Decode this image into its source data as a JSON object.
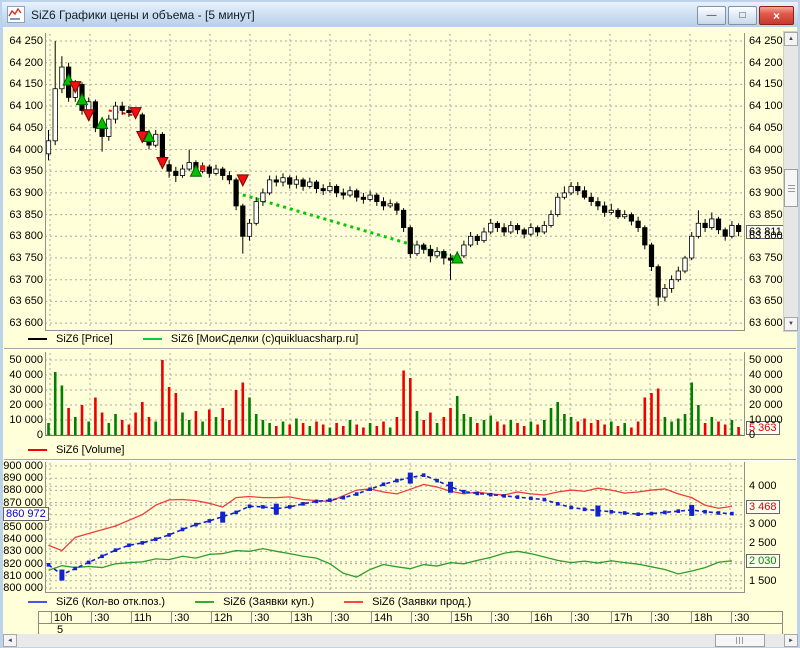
{
  "window": {
    "title": "SiZ6 Графики цены и объема - [5 минут]"
  },
  "titlebar_buttons": {
    "minimize": "—",
    "maximize": "□",
    "close": "×"
  },
  "price_panel": {
    "y_ticks": [
      "64 250",
      "64 200",
      "64 150",
      "64 100",
      "64 050",
      "64 000",
      "63 950",
      "63 900",
      "63 850",
      "63 800",
      "63 750",
      "63 700",
      "63 650",
      "63 600"
    ],
    "last_price": "63 811",
    "legend": [
      {
        "color": "#000000",
        "label": "SiZ6 [Price]"
      },
      {
        "color": "#00cc44",
        "label": "SiZ6 [МоиСделки (с)quikluacsharp.ru]"
      }
    ]
  },
  "volume_panel": {
    "y_ticks": [
      "50 000",
      "40 000",
      "30 000",
      "20 000",
      "10 000",
      "0"
    ],
    "last_value": "5 363",
    "legend": [
      {
        "color": "#ff0000",
        "label": "SiZ6 [Volume]"
      }
    ]
  },
  "bottom_panel": {
    "left_ticks": [
      {
        "label": "900 000",
        "v": 900000
      },
      {
        "label": "890 000",
        "v": 890000
      },
      {
        "label": "880 000",
        "v": 880000
      },
      {
        "label": "870 000",
        "v": 870000
      },
      {
        "label": "850 000",
        "v": 850000
      },
      {
        "label": "840 000",
        "v": 840000
      },
      {
        "label": "830 000",
        "v": 830000
      },
      {
        "label": "820 000",
        "v": 820000
      },
      {
        "label": "810 000",
        "v": 810000
      },
      {
        "label": "800 000",
        "v": 800000
      }
    ],
    "left_badge": "860 972",
    "right_ticks": [
      {
        "label": "4 000",
        "v": 4000
      },
      {
        "label": "3 000",
        "v": 3000
      },
      {
        "label": "2 500",
        "v": 2500
      },
      {
        "label": "1 500",
        "v": 1500
      }
    ],
    "sell_badge": "3 468",
    "buy_badge": "2 030",
    "legend": [
      {
        "color": "#4455ee",
        "label": "SiZ6 (Кол-во отк.поз.)"
      },
      {
        "color": "#33aa33",
        "label": "SiZ6 (Заявки куп.)"
      },
      {
        "color": "#ff4444",
        "label": "SiZ6 (Заявки прод.)"
      }
    ]
  },
  "time_axis": {
    "labels": [
      "10h",
      ":30",
      "11h",
      ":30",
      "12h",
      ":30",
      "13h",
      ":30",
      "14h",
      ":30",
      "15h",
      ":30",
      "16h",
      ":30",
      "17h",
      ":30",
      "18h",
      ":30"
    ],
    "period": "5"
  },
  "chart_data": [
    {
      "type": "candlestick",
      "name": "SiZ6 [Price]",
      "interval": "5 минут",
      "ylim": [
        63600,
        64250
      ],
      "y_step": 50,
      "last": 63811,
      "ohlc": [
        [
          63990,
          64045,
          63975,
          64020
        ],
        [
          64020,
          64250,
          64010,
          64140
        ],
        [
          64140,
          64215,
          64130,
          64190
        ],
        [
          64190,
          64200,
          64110,
          64120
        ],
        [
          64120,
          64160,
          64110,
          64150
        ],
        [
          64150,
          64155,
          64080,
          64090
        ],
        [
          64090,
          64120,
          64080,
          64110
        ],
        [
          64110,
          64115,
          64040,
          64050
        ],
        [
          64050,
          64060,
          63995,
          64030
        ],
        [
          64030,
          64080,
          64020,
          64070
        ],
        [
          64070,
          64110,
          64060,
          64100
        ],
        [
          64100,
          64110,
          64080,
          64090
        ],
        [
          64090,
          64100,
          64075,
          64085
        ],
        [
          64085,
          64095,
          64070,
          64080
        ],
        [
          64080,
          64085,
          64020,
          64030
        ],
        [
          64030,
          64040,
          64000,
          64010
        ],
        [
          64010,
          64045,
          64005,
          64035
        ],
        [
          64035,
          64040,
          63955,
          63965
        ],
        [
          63965,
          63975,
          63935,
          63950
        ],
        [
          63950,
          63960,
          63925,
          63940
        ],
        [
          63940,
          63965,
          63935,
          63955
        ],
        [
          63955,
          64000,
          63950,
          63970
        ],
        [
          63970,
          63975,
          63940,
          63950
        ],
        [
          63950,
          63970,
          63945,
          63960
        ],
        [
          63960,
          63965,
          63935,
          63945
        ],
        [
          63945,
          63965,
          63940,
          63955
        ],
        [
          63955,
          63960,
          63930,
          63940
        ],
        [
          63940,
          63950,
          63920,
          63930
        ],
        [
          63930,
          63935,
          63860,
          63870
        ],
        [
          63870,
          63875,
          63760,
          63800
        ],
        [
          63800,
          63840,
          63790,
          63830
        ],
        [
          63830,
          63890,
          63825,
          63880
        ],
        [
          63880,
          63910,
          63870,
          63900
        ],
        [
          63900,
          63940,
          63895,
          63930
        ],
        [
          63930,
          63940,
          63915,
          63925
        ],
        [
          63925,
          63945,
          63915,
          63935
        ],
        [
          63935,
          63940,
          63910,
          63920
        ],
        [
          63920,
          63940,
          63910,
          63930
        ],
        [
          63930,
          63935,
          63905,
          63915
        ],
        [
          63915,
          63935,
          63910,
          63925
        ],
        [
          63925,
          63930,
          63900,
          63910
        ],
        [
          63910,
          63920,
          63895,
          63905
        ],
        [
          63905,
          63925,
          63900,
          63915
        ],
        [
          63915,
          63920,
          63890,
          63900
        ],
        [
          63900,
          63910,
          63885,
          63895
        ],
        [
          63895,
          63915,
          63890,
          63905
        ],
        [
          63905,
          63910,
          63880,
          63890
        ],
        [
          63890,
          63900,
          63875,
          63885
        ],
        [
          63885,
          63905,
          63880,
          63895
        ],
        [
          63895,
          63900,
          63870,
          63880
        ],
        [
          63880,
          63890,
          63860,
          63870
        ],
        [
          63870,
          63885,
          63865,
          63875
        ],
        [
          63875,
          63880,
          63850,
          63860
        ],
        [
          63860,
          63865,
          63810,
          63820
        ],
        [
          63820,
          63825,
          63750,
          63760
        ],
        [
          63760,
          63790,
          63755,
          63780
        ],
        [
          63780,
          63785,
          63760,
          63770
        ],
        [
          63770,
          63780,
          63740,
          63755
        ],
        [
          63755,
          63775,
          63750,
          63765
        ],
        [
          63765,
          63770,
          63735,
          63750
        ],
        [
          63750,
          63760,
          63700,
          63745
        ],
        [
          63745,
          63765,
          63740,
          63755
        ],
        [
          63755,
          63790,
          63750,
          63780
        ],
        [
          63780,
          63810,
          63775,
          63800
        ],
        [
          63800,
          63805,
          63780,
          63790
        ],
        [
          63790,
          63820,
          63785,
          63810
        ],
        [
          63810,
          63840,
          63805,
          63830
        ],
        [
          63830,
          63835,
          63810,
          63820
        ],
        [
          63820,
          63830,
          63800,
          63810
        ],
        [
          63810,
          63835,
          63805,
          63825
        ],
        [
          63825,
          63830,
          63805,
          63815
        ],
        [
          63815,
          63820,
          63795,
          63805
        ],
        [
          63805,
          63830,
          63800,
          63820
        ],
        [
          63820,
          63825,
          63800,
          63810
        ],
        [
          63810,
          63835,
          63805,
          63825
        ],
        [
          63825,
          63860,
          63820,
          63850
        ],
        [
          63850,
          63900,
          63845,
          63890
        ],
        [
          63890,
          63915,
          63885,
          63900
        ],
        [
          63900,
          63925,
          63895,
          63915
        ],
        [
          63915,
          63925,
          63895,
          63905
        ],
        [
          63905,
          63915,
          63885,
          63890
        ],
        [
          63890,
          63900,
          63870,
          63880
        ],
        [
          63880,
          63890,
          63860,
          63870
        ],
        [
          63870,
          63880,
          63845,
          63855
        ],
        [
          63855,
          63875,
          63850,
          63860
        ],
        [
          63860,
          63865,
          63840,
          63845
        ],
        [
          63845,
          63860,
          63840,
          63850
        ],
        [
          63850,
          63855,
          63825,
          63835
        ],
        [
          63835,
          63845,
          63810,
          63820
        ],
        [
          63820,
          63825,
          63770,
          63780
        ],
        [
          63780,
          63785,
          63720,
          63730
        ],
        [
          63730,
          63735,
          63640,
          63660
        ],
        [
          63660,
          63690,
          63650,
          63680
        ],
        [
          63680,
          63710,
          63670,
          63700
        ],
        [
          63700,
          63730,
          63695,
          63720
        ],
        [
          63720,
          63755,
          63715,
          63750
        ],
        [
          63750,
          63810,
          63745,
          63800
        ],
        [
          63800,
          63860,
          63795,
          63830
        ],
        [
          63830,
          63840,
          63810,
          63820
        ],
        [
          63820,
          63855,
          63815,
          63840
        ],
        [
          63840,
          63845,
          63805,
          63815
        ],
        [
          63815,
          63820,
          63790,
          63800
        ],
        [
          63800,
          63835,
          63795,
          63825
        ],
        [
          63825,
          63830,
          63800,
          63811
        ]
      ],
      "buy_markers": [
        [
          3,
          64160
        ],
        [
          5,
          64115
        ],
        [
          8,
          64060
        ],
        [
          15,
          64030
        ],
        [
          22,
          63950
        ],
        [
          61,
          63750
        ]
      ],
      "sell_markers": [
        [
          4,
          64145
        ],
        [
          6,
          64080
        ],
        [
          13,
          64085
        ],
        [
          14,
          64030
        ],
        [
          17,
          63970
        ],
        [
          29,
          63930
        ]
      ],
      "sell_dot": [
        [
          23,
          63958
        ]
      ],
      "trend_lines": [
        {
          "color": "#ff0000",
          "from": [
            9,
            64090
          ],
          "to": [
            13,
            64078
          ]
        },
        {
          "color": "#00cc00",
          "from": [
            28,
            63900
          ],
          "to": [
            61,
            63750
          ]
        }
      ]
    },
    {
      "type": "bar",
      "name": "SiZ6 [Volume]",
      "ylim": [
        0,
        50000
      ],
      "last": 5363,
      "values": [
        8000,
        42000,
        33000,
        18000,
        12000,
        20000,
        9000,
        25000,
        15000,
        8000,
        14000,
        10000,
        7000,
        15000,
        22000,
        12000,
        9000,
        50000,
        32000,
        28000,
        15000,
        10000,
        16000,
        9000,
        17000,
        12000,
        18000,
        10000,
        30000,
        35000,
        25000,
        14000,
        10000,
        8000,
        6000,
        9000,
        7000,
        11000,
        8000,
        6000,
        9000,
        7000,
        5000,
        8000,
        6000,
        10000,
        7000,
        5000,
        8000,
        6000,
        9000,
        5000,
        12000,
        43000,
        38000,
        16000,
        10000,
        15000,
        8000,
        12000,
        18000,
        26000,
        14000,
        12000,
        8000,
        10000,
        13000,
        9000,
        7000,
        10000,
        8000,
        6000,
        9000,
        7000,
        10000,
        18000,
        22000,
        14000,
        12000,
        9000,
        11000,
        8000,
        10000,
        7000,
        9000,
        6000,
        8000,
        5000,
        9000,
        25000,
        28000,
        31000,
        12000,
        9000,
        11000,
        14000,
        35000,
        20000,
        8000,
        12000,
        9000,
        7000,
        10000,
        5363
      ]
    },
    {
      "type": "line",
      "left_ylim": [
        800000,
        900000
      ],
      "right_ylim": [
        1500,
        4000
      ],
      "x_step_bars": 2,
      "series": [
        {
          "name": "SiZ6 (Кол-во отк.поз.)",
          "axis": "left",
          "color": "#1222cc",
          "style": "dashed-squares",
          "last": 860972,
          "big_markers": [
            1,
            13,
            17,
            27,
            30,
            41,
            48
          ],
          "values": [
            819000,
            811000,
            816000,
            821000,
            826000,
            831000,
            835000,
            837000,
            840000,
            843500,
            848000,
            852000,
            855000,
            858500,
            862000,
            867000,
            866500,
            865000,
            866500,
            869000,
            871000,
            872000,
            874000,
            877000,
            881000,
            885000,
            888000,
            890500,
            892500,
            888000,
            883000,
            879000,
            877500,
            876500,
            875500,
            874500,
            873500,
            872500,
            869000,
            866000,
            864500,
            863500,
            862500,
            861500,
            860500,
            861000,
            862000,
            863000,
            864000,
            862500,
            861500,
            860972
          ]
        },
        {
          "name": "SiZ6 (Заявки куп.)",
          "axis": "right",
          "color": "#2e9e2e",
          "style": "solid",
          "last": 2030,
          "values": [
            1780,
            1900,
            1850,
            1880,
            1850,
            1950,
            1980,
            2000,
            2080,
            2060,
            2150,
            2100,
            2200,
            2220,
            2300,
            2280,
            2350,
            2280,
            2220,
            2150,
            2100,
            1950,
            1700,
            1600,
            1800,
            1930,
            1870,
            1820,
            1930,
            1890,
            1980,
            1950,
            2040,
            2120,
            2230,
            2280,
            2220,
            2130,
            2040,
            1980,
            2020,
            1970,
            2030,
            1980,
            1940,
            1870,
            1800,
            1680,
            1760,
            1850,
            1990,
            2030
          ]
        },
        {
          "name": "SiZ6 (Заявки прод.)",
          "axis": "right",
          "color": "#f23c3c",
          "style": "solid",
          "last": 3468,
          "values": [
            2440,
            2300,
            2650,
            2750,
            2850,
            2950,
            3100,
            3250,
            3500,
            3640,
            3650,
            3620,
            3550,
            3450,
            3700,
            3730,
            3700,
            3700,
            3720,
            3650,
            3620,
            3600,
            3750,
            3900,
            3930,
            3850,
            3800,
            3920,
            4050,
            3980,
            3870,
            3800,
            3850,
            3800,
            3770,
            3850,
            3800,
            3770,
            3850,
            3900,
            3870,
            3950,
            3900,
            3820,
            3850,
            3900,
            3930,
            3800,
            3700,
            3500,
            3420,
            3468
          ]
        }
      ]
    }
  ]
}
